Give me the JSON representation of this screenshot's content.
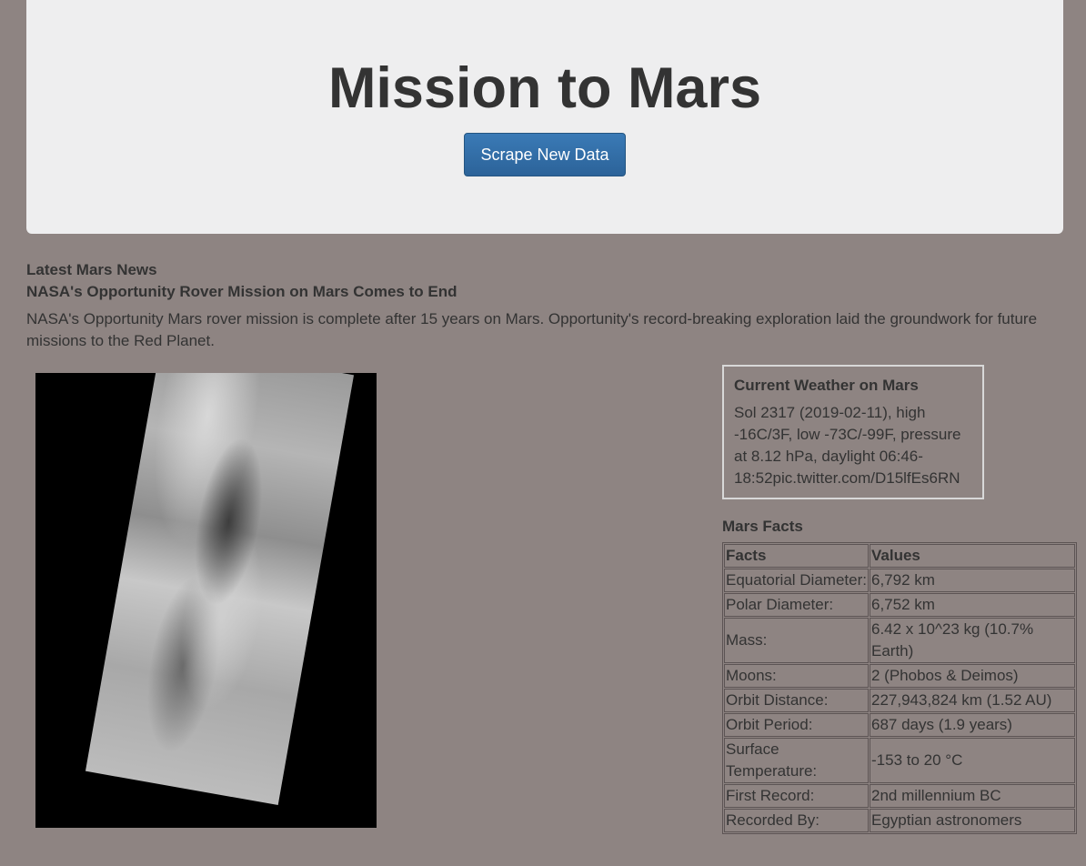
{
  "header": {
    "title": "Mission to Mars",
    "scrape_button_label": "Scrape New Data"
  },
  "news": {
    "section_heading": "Latest Mars News",
    "title": "NASA's Opportunity Rover Mission on Mars Comes to End",
    "paragraph": "NASA's Opportunity Mars rover mission is complete after 15 years on Mars. Opportunity's record-breaking exploration laid the groundwork for future missions to the Red Planet."
  },
  "weather": {
    "heading": "Current Weather on Mars",
    "text": "Sol 2317 (2019-02-11), high -16C/3F, low -73C/-99F, pressure at 8.12 hPa, daylight 06:46-18:52pic.twitter.com/D15lfEs6RN"
  },
  "facts": {
    "heading": "Mars Facts",
    "columns": [
      "Facts",
      "Values"
    ],
    "rows": [
      [
        "Equatorial Diameter:",
        "6,792 km"
      ],
      [
        "Polar Diameter:",
        "6,752 km"
      ],
      [
        "Mass:",
        "6.42 x 10^23 kg (10.7% Earth)"
      ],
      [
        "Moons:",
        "2 (Phobos & Deimos)"
      ],
      [
        "Orbit Distance:",
        "227,943,824 km (1.52 AU)"
      ],
      [
        "Orbit Period:",
        "687 days (1.9 years)"
      ],
      [
        "Surface Temperature:",
        "-153 to 20 °C"
      ],
      [
        "First Record:",
        "2nd millennium BC"
      ],
      [
        "Recorded By:",
        "Egyptian astronomers"
      ]
    ]
  }
}
